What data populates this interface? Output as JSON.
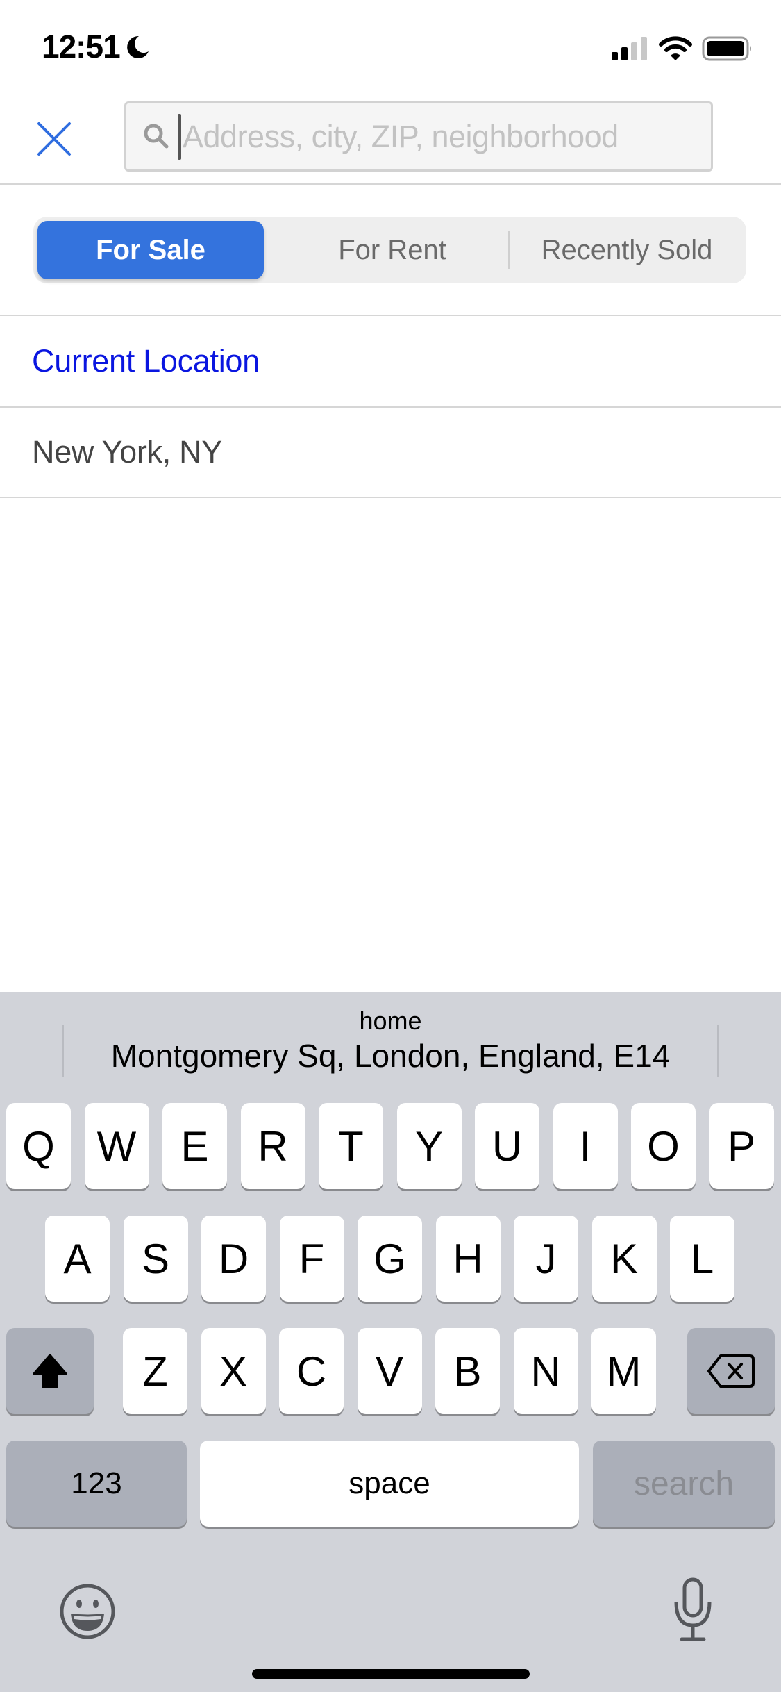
{
  "status_bar": {
    "time": "12:51",
    "focus_icon": "moon-icon",
    "signal_bars_active": 2,
    "signal_bars_total": 4,
    "wifi_icon": "wifi-icon",
    "battery_icon": "battery-icon"
  },
  "header": {
    "close_icon": "close-icon",
    "search": {
      "icon": "search-icon",
      "value": "",
      "placeholder": "Address, city, ZIP, neighborhood"
    }
  },
  "segments": {
    "selected": "For Sale",
    "items": [
      {
        "label": "For Sale",
        "active": true
      },
      {
        "label": "For Rent",
        "active": false
      },
      {
        "label": "Recently Sold",
        "active": false
      }
    ]
  },
  "locations": [
    {
      "label": "Current Location",
      "style": "link"
    },
    {
      "label": "New York, NY",
      "style": "plain"
    }
  ],
  "keyboard": {
    "suggestion": {
      "label": "home",
      "value": "Montgomery Sq, London, England, E14"
    },
    "row1": [
      "Q",
      "W",
      "E",
      "R",
      "T",
      "Y",
      "U",
      "I",
      "O",
      "P"
    ],
    "row2": [
      "A",
      "S",
      "D",
      "F",
      "G",
      "H",
      "J",
      "K",
      "L"
    ],
    "row3": [
      "Z",
      "X",
      "C",
      "V",
      "B",
      "N",
      "M"
    ],
    "shift_icon": "shift-icon",
    "delete_icon": "backspace-icon",
    "numbers_label": "123",
    "space_label": "space",
    "return_label": "search",
    "emoji_icon": "emoji-icon",
    "mic_icon": "microphone-icon"
  },
  "colors": {
    "accent": "#3473dd",
    "link": "#0a16e0",
    "keyboard_bg": "#d1d3d9"
  }
}
